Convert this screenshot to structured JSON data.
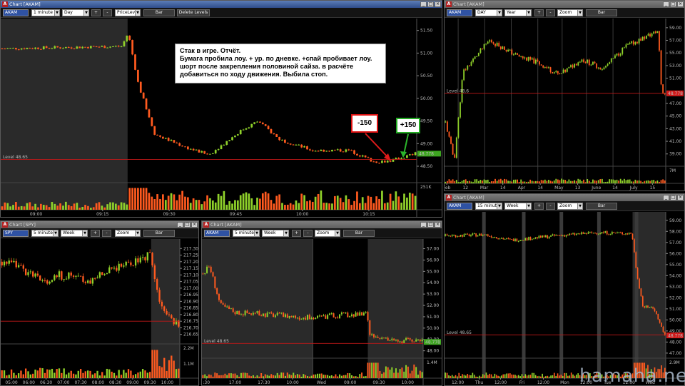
{
  "colors": {
    "up": "#8fd12a",
    "down": "#ff5a1f",
    "level": "#c01818",
    "session_bg": "#2a2a2a",
    "current_label_bg": "#3da520",
    "current_label_bg_red": "#d21b1b"
  },
  "annotations": {
    "note_lines": [
      "Стак в игре. Отчёт.",
      "Бумага пробила лоу. + ур. по дневке. +спай пробивает лоу.",
      "шорт после закрепления половиной сайза. в расчёте",
      "добавиться по ходу движения. Выбила стоп."
    ],
    "loss_label": "-150",
    "profit_label": "+150",
    "watermark": "hamaha.net"
  },
  "windows": {
    "w1": {
      "title": "Chart [AKAM]",
      "symbol": "AKAM",
      "interval": "1 minute",
      "range": "Day",
      "level_mode": "PriceLevel",
      "bar_label": "Bar",
      "delete_label": "Delete Levels",
      "plus": "+",
      "minus": "-",
      "level_text": "Level 48.65",
      "current_price": "48.778",
      "price_ticks": [
        [
          "51.50",
          51.5
        ],
        [
          "51.00",
          51.0
        ],
        [
          "50.50",
          50.5
        ],
        [
          "50.00",
          50.0
        ],
        [
          "49.50",
          49.5
        ],
        [
          "49.00",
          49.0
        ],
        [
          "48.50",
          48.5
        ]
      ],
      "volume_label": "251K",
      "time_ticks": [
        "09:00",
        "09:15",
        "09:30",
        "09:45",
        "10:00",
        "10:15"
      ]
    },
    "w2": {
      "title": "Chart [AKAM]",
      "symbol": "AKAM",
      "interval": "DAY",
      "range": "Year",
      "zoom": "Zoom",
      "bar_label": "Bar",
      "plus": "+",
      "minus": "-",
      "level_text": "Level 48.6",
      "current_price": "48.778",
      "price_ticks": [
        [
          "59.00",
          59
        ],
        [
          "57.00",
          57
        ],
        [
          "55.00",
          55
        ],
        [
          "53.00",
          53
        ],
        [
          "51.00",
          51
        ],
        [
          "47.00",
          47
        ],
        [
          "45.00",
          45
        ],
        [
          "43.00",
          43
        ],
        [
          "41.00",
          41
        ],
        [
          "39.00",
          39
        ]
      ],
      "volume_label": "7M",
      "time_ticks": [
        "Feb",
        "12",
        "Mar",
        "14",
        "Apr",
        "14",
        "May",
        "13",
        "June",
        "14",
        "July",
        "15"
      ]
    },
    "w3": {
      "title": "Chart [SPY]",
      "symbol": "SPY",
      "interval": "5 minutes",
      "range": "Week",
      "zoom": "Zoom",
      "bar_label": "Bar",
      "plus": "+",
      "minus": "-",
      "price_ticks": [
        [
          "217.30",
          217.3
        ],
        [
          "217.25",
          217.25
        ],
        [
          "217.20",
          217.2
        ],
        [
          "217.15",
          217.15
        ],
        [
          "217.10",
          217.1
        ],
        [
          "217.05",
          217.05
        ],
        [
          "217.00",
          217.0
        ],
        [
          "216.95",
          216.95
        ],
        [
          "216.90",
          216.9
        ],
        [
          "216.85",
          216.85
        ],
        [
          "216.80",
          216.8
        ],
        [
          "216.75",
          216.75
        ],
        [
          "216.70",
          216.7
        ],
        [
          "216.65",
          216.65
        ]
      ],
      "volume_labels": [
        "2.2M",
        "1.1M"
      ],
      "time_ticks": [
        "05:00",
        "06:00",
        "06:30",
        "07:00",
        "07:30",
        "08:00",
        "08:30",
        "09:00",
        "09:30",
        "10:00"
      ]
    },
    "w4": {
      "title": "Chart [AKAM]",
      "symbol": "AKAM",
      "interval": "5 minutes",
      "range": "Week",
      "zoom": "Zoom",
      "bar_label": "Bar",
      "plus": "+",
      "minus": "-",
      "level_text": "Level 48.65",
      "current_price": "48.778",
      "price_ticks": [
        [
          "57.00",
          57
        ],
        [
          "56.00",
          56
        ],
        [
          "55.00",
          55
        ],
        [
          "54.00",
          54
        ],
        [
          "53.00",
          53
        ],
        [
          "52.00",
          52
        ],
        [
          "51.00",
          51
        ],
        [
          "50.00",
          50
        ],
        [
          "49.00",
          49
        ],
        [
          "48.00",
          48
        ]
      ],
      "volume_label": "1.4M",
      "time_ticks": [
        ":30",
        "17:00",
        "17:30",
        "10:00",
        "Wed",
        "09:00",
        "09:30",
        "10:00"
      ]
    },
    "w5": {
      "title": "Chart [AKAM]",
      "symbol": "AKAM",
      "interval": "15 minutes",
      "range": "Week",
      "zoom": "Zoom",
      "bar_label": "Bar",
      "plus": "+",
      "minus": "-",
      "level_text": "Level 48.65",
      "current_price": "48.778",
      "price_ticks": [
        [
          "59.00",
          59
        ],
        [
          "58.00",
          58
        ],
        [
          "57.00",
          57
        ],
        [
          "56.00",
          56
        ],
        [
          "55.00",
          55
        ],
        [
          "54.00",
          54
        ],
        [
          "53.00",
          53
        ],
        [
          "52.00",
          52
        ],
        [
          "51.00",
          51
        ],
        [
          "50.00",
          50
        ],
        [
          "49.00",
          49
        ],
        [
          "48.00",
          48
        ],
        [
          "47.00",
          47
        ]
      ],
      "volume_label": "2.9M",
      "time_ticks": [
        "12:00",
        "Thu",
        "12:00",
        "Fri",
        "12:00",
        "Mon",
        "12:00",
        "Tue",
        "12:00",
        "Wed"
      ]
    }
  }
}
